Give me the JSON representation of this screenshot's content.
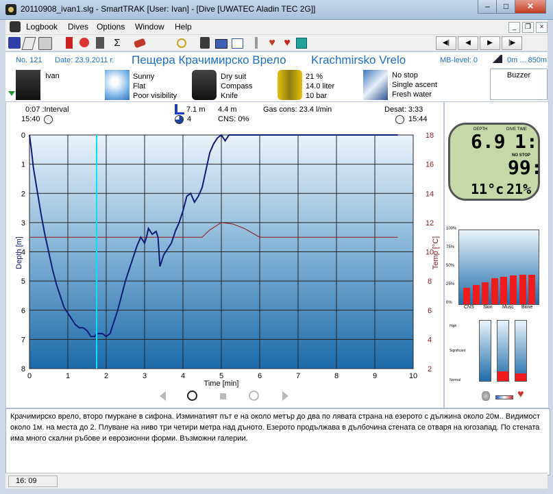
{
  "window": {
    "title": "20110908_ivan1.slg - SmartTRAK  [User: Ivan] - [Dive  [UWATEC Aladin TEC 2G]]"
  },
  "menu": [
    "Logbook",
    "Dives",
    "Options",
    "Window",
    "Help"
  ],
  "toolbar_icons": [
    "logbook-icon",
    "eraser-icon",
    "print-icon",
    "add-dive-icon",
    "delete-icon",
    "trash-icon",
    "sum-icon",
    "transfer-icon",
    "watch-icon",
    "profile-icon",
    "mail-icon",
    "chart-icon",
    "pin-icon",
    "heart-broken-icon",
    "heart-icon",
    "settings-icon"
  ],
  "header": {
    "dive_no": "No. 121",
    "date": "Date: 23.9.2011 г.",
    "location_bg": "Пещера Крачимирско Врело",
    "location_en": "Krachmirsko Vrelo",
    "mb_level": "MB-level: 0",
    "altitude": "0m ... 850m",
    "buddy": "Ivan",
    "weather": [
      "Sunny",
      "Flat",
      "Poor visibility"
    ],
    "equipment": [
      "Dry suit",
      "Compass",
      "Knife"
    ],
    "gas": [
      "21 %",
      "14.0 liter",
      "10 bar"
    ],
    "deco": [
      "No stop",
      "Single ascent",
      "Fresh water"
    ],
    "buzzer": "Buzzer"
  },
  "stats": {
    "interval": "0:07 :Interval",
    "entry_time": "15:40",
    "max_depth": "7.1 m",
    "avg_depth": "4.4 m",
    "gas_cons": "Gas cons: 23.4 l/min",
    "desat": "Desat:  3:33",
    "ascent_count": "4",
    "cns": "CNS:  0%",
    "exit_time": "15:44"
  },
  "colors": {
    "profile": "#0d1a78",
    "temp": "#8b1a1a",
    "cursor": "#00e5ff",
    "accent": "#1e6ec8",
    "bar_red": "#ee1c1c"
  },
  "chart_data": {
    "type": "line",
    "xlabel": "Time [min]",
    "ylabel": "Depth [m]",
    "y2label": "Temp [°C]",
    "xlim": [
      0,
      10
    ],
    "ylim": [
      0,
      8
    ],
    "y2lim": [
      2,
      18
    ],
    "xticks": [
      "0",
      "1",
      "2",
      "3",
      "4",
      "5",
      "6",
      "7",
      "8",
      "9",
      "10"
    ],
    "yticks": [
      "0",
      "1",
      "2",
      "3",
      "4",
      "5",
      "6",
      "7",
      "8"
    ],
    "y2ticks": [
      "18",
      "16",
      "14",
      "12",
      "10",
      "8",
      "6",
      "4",
      "2"
    ],
    "cursor_x": 1.75,
    "series": [
      {
        "x": [
          0,
          0.05,
          0.1,
          0.2,
          0.3,
          0.4,
          0.5,
          0.6,
          0.7,
          0.8,
          0.9,
          1.0,
          1.1,
          1.2,
          1.3,
          1.4,
          1.5,
          1.6,
          1.7,
          1.75,
          1.8,
          1.9,
          2.0,
          2.1,
          2.2,
          2.3,
          2.4,
          2.5,
          2.6,
          2.7,
          2.8,
          2.9,
          3.0,
          3.05,
          3.1,
          3.15,
          3.2,
          3.3,
          3.35,
          3.4,
          3.5,
          3.6,
          3.7,
          3.8,
          3.9,
          4.0,
          4.1,
          4.2,
          4.3,
          4.4,
          4.5,
          4.6,
          4.7,
          4.8,
          4.9,
          5.0,
          5.1,
          5.2,
          5.4,
          5.6,
          5.8,
          6.0,
          6.2,
          6.4,
          6.6,
          6.8,
          7.0,
          7.2,
          7.4,
          7.6,
          7.8,
          8.0,
          8.2,
          8.4,
          8.6,
          8.8,
          9.0,
          9.2,
          9.4,
          9.6
        ],
        "y": [
          0,
          0.5,
          1.1,
          1.9,
          2.7,
          3.4,
          4.0,
          4.6,
          5.1,
          5.5,
          5.9,
          6.1,
          6.3,
          6.5,
          6.6,
          6.6,
          6.7,
          6.9,
          6.9,
          6.8,
          6.8,
          6.8,
          6.9,
          6.8,
          6.4,
          6.0,
          5.5,
          5.0,
          4.6,
          4.2,
          3.8,
          3.5,
          3.7,
          3.5,
          3.2,
          3.3,
          3.4,
          3.3,
          3.5,
          4.5,
          4.1,
          3.9,
          3.7,
          3.3,
          3.0,
          2.6,
          2.1,
          2.0,
          2.3,
          2.1,
          1.8,
          1.2,
          0.6,
          0.3,
          0.1,
          0.0,
          0.2,
          0.0,
          0.0,
          0.0,
          0.0,
          0.0,
          0.0,
          0.0,
          0.0,
          0.0,
          0.0,
          0.0,
          0.0,
          0.0,
          0.0,
          0.0,
          0.0,
          0.0,
          0.0,
          0.0,
          0.0,
          0.0,
          0.0,
          0.0
        ]
      },
      {
        "x": [
          0,
          4.3,
          4.5,
          4.7,
          5.0,
          5.3,
          5.6,
          5.8,
          6.0,
          7.0,
          8.0,
          9.0,
          9.6
        ],
        "y2": [
          11,
          11,
          11,
          11.5,
          12,
          11.9,
          11.6,
          11.3,
          11,
          11,
          11,
          11,
          11
        ]
      }
    ]
  },
  "nav_buttons": [
    "first-dive-button",
    "prev-dive-button",
    "next-dive-button",
    "last-dive-button"
  ],
  "computer": {
    "depth": "6.9",
    "dive_time": "1:",
    "no_stop_label": "NO STOP",
    "no_stop": "99:",
    "temp": "11°c",
    "o2": "21%",
    "depth_label": "DEPTH",
    "dive_time_label": "DIVE TIME"
  },
  "tissues": {
    "ticks": [
      "100%",
      "75%",
      "50%",
      "25%",
      "0%"
    ],
    "labels": [
      "CNS",
      "Skin",
      "Musc",
      "Bone"
    ],
    "values": [
      22,
      26,
      30,
      35,
      37,
      39,
      40,
      40
    ]
  },
  "tissue_bars": {
    "labels": [
      "High",
      "Significant",
      "Normal"
    ],
    "fills": [
      0,
      0.16,
      0.12
    ]
  },
  "notes": {
    "text": "Крачимирско врело, второ гмуркане в сифона. Изминатият път е на около метър до два по лявата страна на езерото с дължина около 20м.. Видимост около 1м. на места до 2. Плуване на ниво три четири метра над дъното. Езерото продължава в дълбочина стената се отваря на югозапад. По стената има много скални ръбове и еврозионни форми. Възможни галерии."
  },
  "statusbar": {
    "time": "16: 09"
  }
}
